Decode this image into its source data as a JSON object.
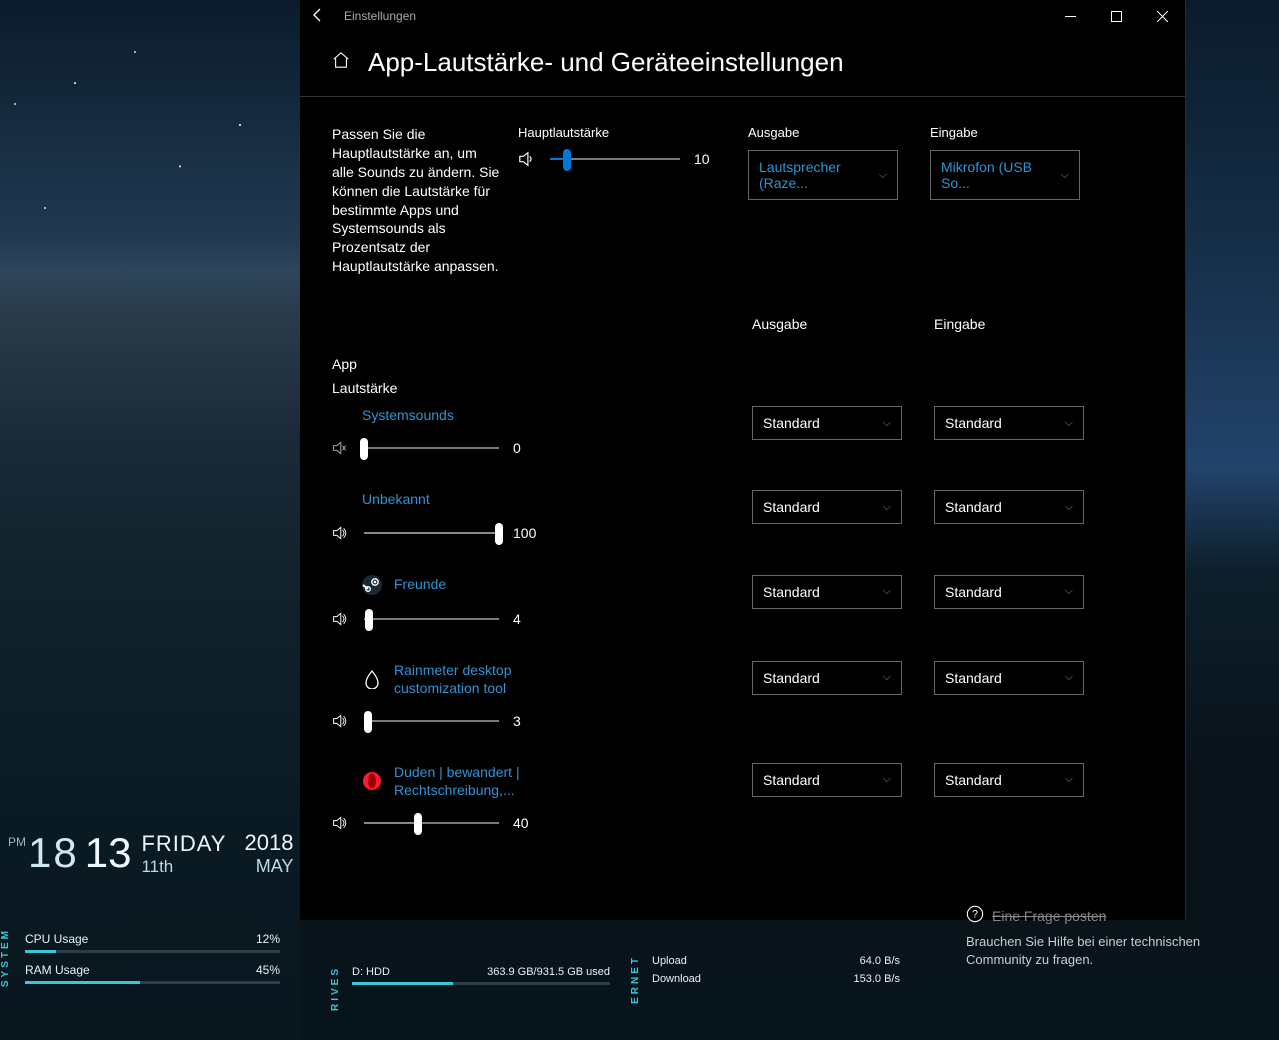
{
  "window": {
    "title": "Einstellungen",
    "page_title": "App-Lautstärke- und Geräteeinstellungen"
  },
  "main": {
    "description": "Passen Sie die Hauptlautstärke an, um alle Sounds zu ändern. Sie können die Lautstärke für bestimmte Apps und Systemsounds als Prozentsatz der Hauptlautstärke anpassen.",
    "master_label": "Hauptlautstärke",
    "master_value": "10",
    "output_label": "Ausgabe",
    "input_label": "Eingabe",
    "output_device": "Lautsprecher (Raze...",
    "input_device": "Mikrofon (USB So..."
  },
  "apps_section": {
    "app_heading": "App",
    "volume_heading": "Lautstärke",
    "output_heading": "Ausgabe",
    "input_heading": "Eingabe",
    "standard_label": "Standard",
    "items": [
      {
        "name": "Systemsounds",
        "value": "0",
        "pct": 0,
        "icon": "none",
        "muted": true
      },
      {
        "name": "Unbekannt",
        "value": "100",
        "pct": 100,
        "icon": "none",
        "muted": false
      },
      {
        "name": "Freunde",
        "value": "4",
        "pct": 4,
        "icon": "steam",
        "muted": false
      },
      {
        "name": "Rainmeter desktop customization tool",
        "value": "3",
        "pct": 3,
        "icon": "rainmeter",
        "muted": false
      },
      {
        "name": "Duden | bewandert | Rechtschreibung,...",
        "value": "40",
        "pct": 40,
        "icon": "opera",
        "muted": false
      }
    ]
  },
  "help": {
    "title": "Eine Frage posten",
    "body": "Brauchen Sie Hilfe bei einer technischen Community zu fragen."
  },
  "rainmeter": {
    "clock": {
      "ampm": "PM",
      "hour": "18",
      "min": "13",
      "weekday": "FRIDAY",
      "daynum": "11th",
      "year": "2018",
      "month": "MAY"
    },
    "system": {
      "label": "SYSTEM",
      "cpu_label": "CPU Usage",
      "cpu_val": "12%",
      "cpu_pct": 12,
      "ram_label": "RAM Usage",
      "ram_val": "45%",
      "ram_pct": 45
    },
    "drive": {
      "label": "RIVES",
      "name": "D: HDD",
      "usage": "363.9 GB/931.5 GB used"
    },
    "net": {
      "label": "ERNET",
      "up_label": "Upload",
      "up_val": "64.0 B/s",
      "down_label": "Download",
      "down_val": "153.0 B/s"
    }
  }
}
